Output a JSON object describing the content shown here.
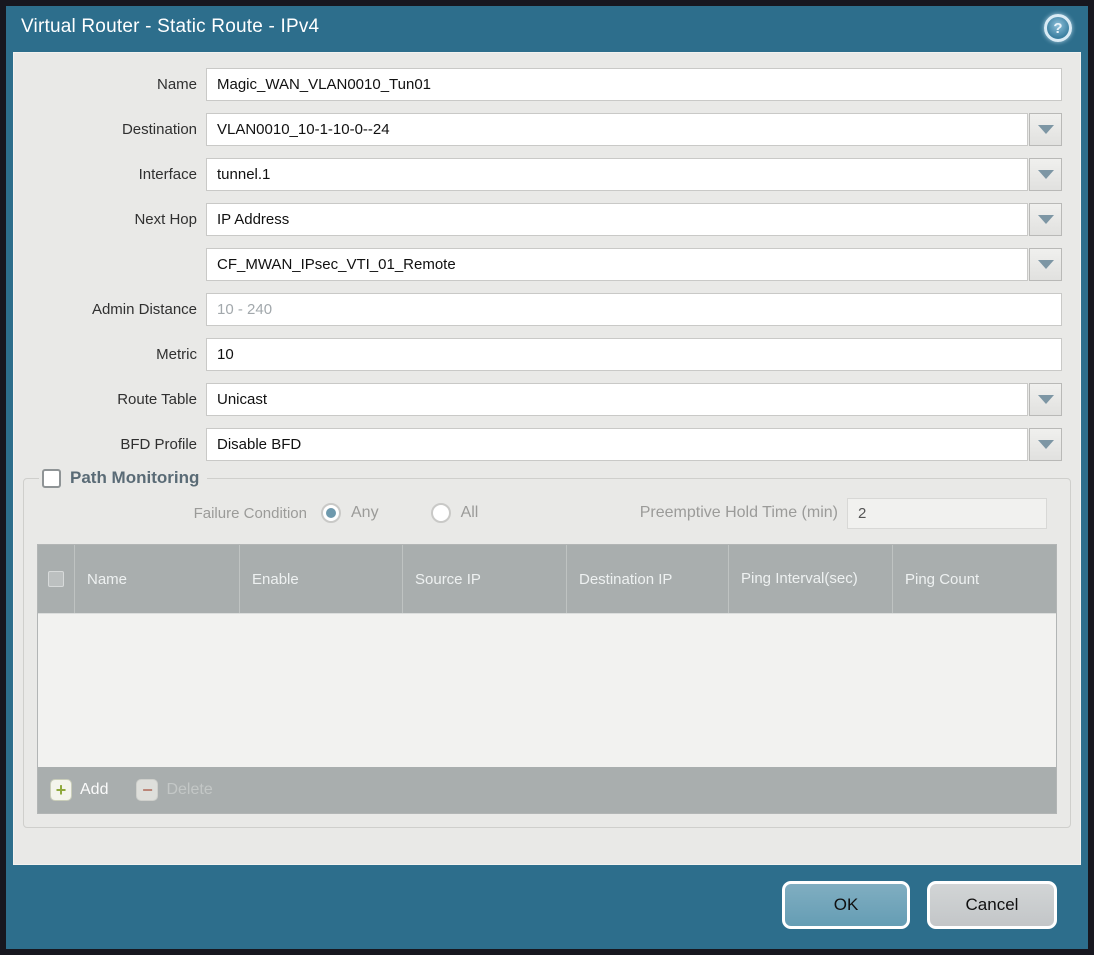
{
  "dialog": {
    "title": "Virtual Router - Static Route - IPv4",
    "help_icon": "?"
  },
  "form": {
    "name": {
      "label": "Name",
      "value": "Magic_WAN_VLAN0010_Tun01"
    },
    "destination": {
      "label": "Destination",
      "value": "VLAN0010_10-1-10-0--24"
    },
    "interface": {
      "label": "Interface",
      "value": "tunnel.1"
    },
    "next_hop": {
      "label": "Next Hop",
      "value": "IP Address"
    },
    "next_hop_address": {
      "value": "CF_MWAN_IPsec_VTI_01_Remote"
    },
    "admin_distance": {
      "label": "Admin Distance",
      "placeholder": "10 - 240"
    },
    "metric": {
      "label": "Metric",
      "value": "10"
    },
    "route_table": {
      "label": "Route Table",
      "value": "Unicast"
    },
    "bfd_profile": {
      "label": "BFD Profile",
      "value": "Disable BFD"
    }
  },
  "path_monitoring": {
    "title": "Path Monitoring",
    "checked": false,
    "failure_condition": {
      "label": "Failure Condition",
      "options": [
        "Any",
        "All"
      ],
      "selected": "Any"
    },
    "preemptive_hold_time": {
      "label": "Preemptive Hold Time (min)",
      "value": "2"
    },
    "table": {
      "columns": [
        "Name",
        "Enable",
        "Source IP",
        "Destination IP",
        "Ping Interval(sec)",
        "Ping Count"
      ],
      "rows": []
    },
    "toolbar": {
      "add_label": "Add",
      "delete_label": "Delete"
    }
  },
  "footer": {
    "ok_label": "OK",
    "cancel_label": "Cancel"
  },
  "colors": {
    "title_bar_teal": "#2d6e8c",
    "content_background": "#e9e9e7",
    "table_header_grey": "#a9aeae",
    "ok_button_teal": "#6fa1b5",
    "cancel_button_grey": "#c9cccd",
    "add_icon_green": "#8fa83c",
    "delete_icon_red": "#bb8577",
    "selected_radio_teal": "#6e99ad"
  }
}
